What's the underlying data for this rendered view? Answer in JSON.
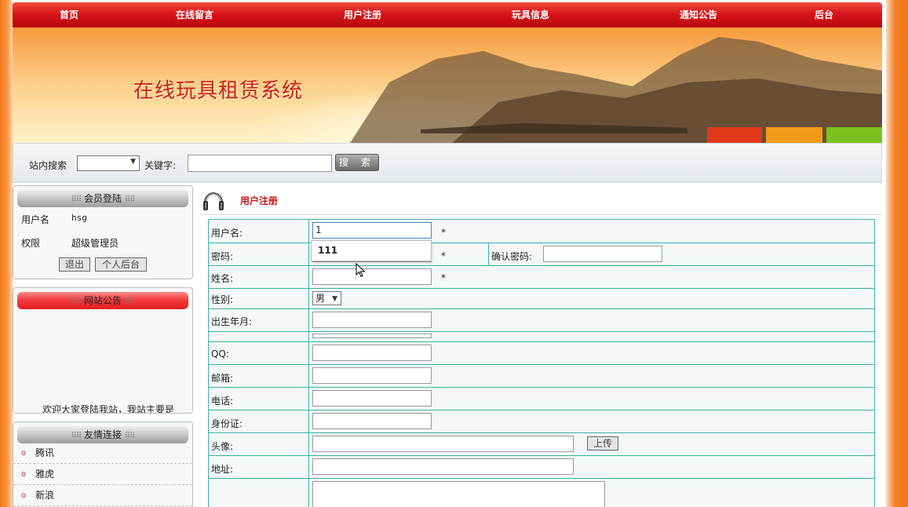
{
  "nav": {
    "items": [
      {
        "label": "首页"
      },
      {
        "label": "在线留言"
      },
      {
        "label": "用户注册"
      },
      {
        "label": "玩具信息"
      },
      {
        "label": "通知公告"
      },
      {
        "label": "后台"
      }
    ]
  },
  "banner": {
    "title": "在线玩具租赁系统"
  },
  "search": {
    "site_search_label": "站内搜索",
    "select_value": "",
    "keyword_label": "关键字:",
    "keyword_value": "",
    "button_label": "搜 索"
  },
  "member_panel": {
    "title": "会员登陆",
    "username_label": "用户名",
    "username_value": "hsg",
    "role_label": "权限",
    "role_value": "超级管理员",
    "logout_label": "退出",
    "backend_label": "个人后台"
  },
  "notice_panel": {
    "title": "网站公告",
    "text": "欢迎大家登陆我站，我站主要是"
  },
  "links_panel": {
    "title": "友情连接",
    "items": [
      {
        "label": "腾讯"
      },
      {
        "label": "雅虎"
      },
      {
        "label": "新浪"
      }
    ]
  },
  "content": {
    "title": "用户注册"
  },
  "form": {
    "username_label": "用户名:",
    "username_value": "1",
    "autocomplete_suggestion": "111",
    "password_label": "密码:",
    "confirm_password_label": "确认密码:",
    "name_label": "姓名:",
    "gender_label": "性别:",
    "gender_value": "男",
    "birth_label": "出生年月:",
    "qq_label": "QQ:",
    "email_label": "邮箱:",
    "phone_label": "电话:",
    "idcard_label": "身份证:",
    "avatar_label": "头像:",
    "upload_label": "上传",
    "address_label": "地址:",
    "required_mark": "*"
  }
}
